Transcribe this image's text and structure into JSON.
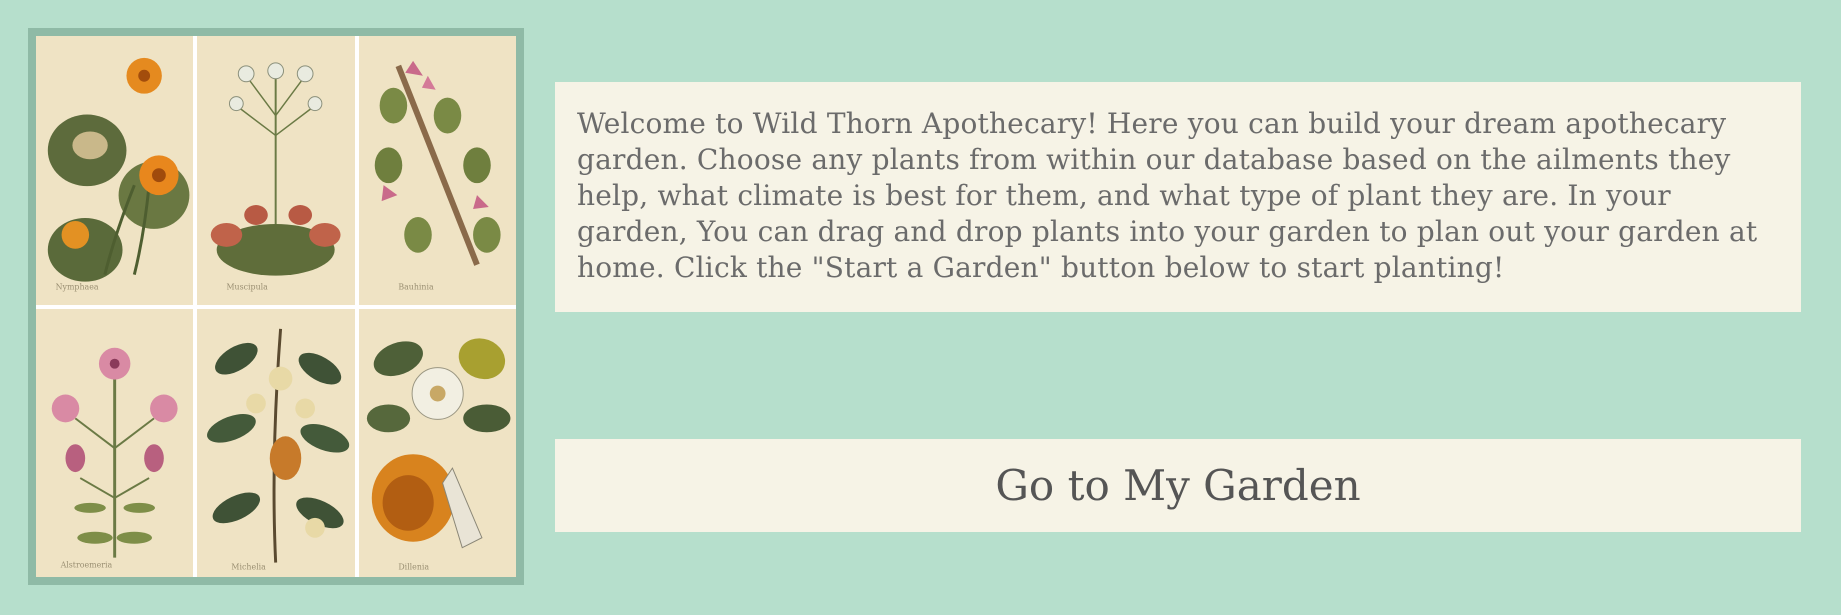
{
  "intro": {
    "text": "Welcome to Wild Thorn Apothecary! Here you can build your dream apothecary garden. Choose any plants from within our database based on the ailments they help, what climate is best for them, and what type of plant they are. In your garden, You can drag and drop plants into your garden to plan out your garden at home. Click the \"Start a Garden\" button below to start planting!"
  },
  "cta": {
    "label": "Go to My Garden"
  },
  "gallery": {
    "plates": [
      {
        "icon": "orange-lily-lotus-plate"
      },
      {
        "icon": "white-flower-flytrap-plate"
      },
      {
        "icon": "pink-flower-pod-vine-plate"
      },
      {
        "icon": "pink-lily-branch-plate"
      },
      {
        "icon": "cream-flower-leafy-branch-plate"
      },
      {
        "icon": "magnolia-fruit-plate"
      }
    ]
  },
  "colors": {
    "background": "#b6dfcc",
    "frame": "#8fbaa6",
    "panel": "#f6f3e6",
    "text": "#6b6b6b"
  }
}
